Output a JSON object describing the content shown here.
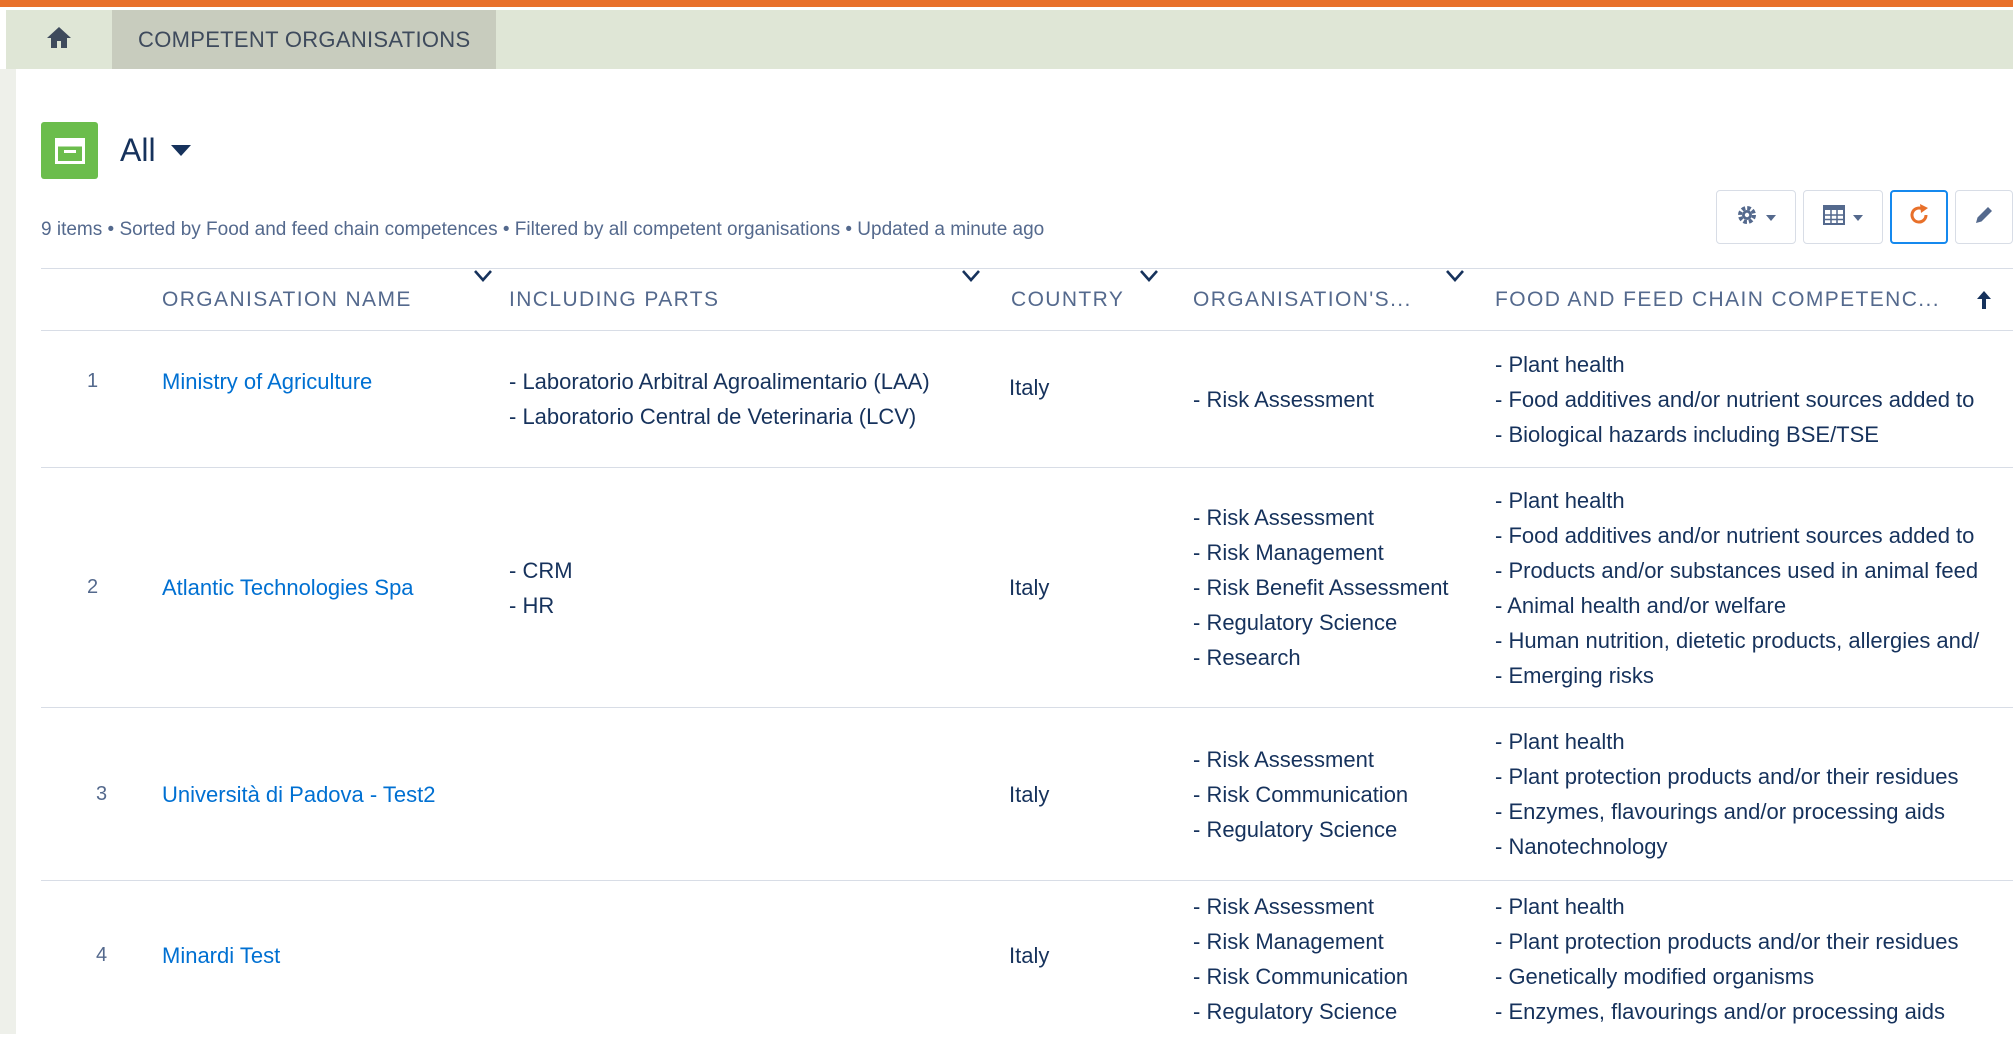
{
  "nav": {
    "tab_label": "COMPETENT ORGANISATIONS"
  },
  "list_view": {
    "title": "All",
    "summary": "9 items • Sorted by Food and feed chain competences • Filtered by all competent organisations • Updated a minute ago"
  },
  "table": {
    "columns": [
      "ORGANISATION NAME",
      "INCLUDING PARTS",
      "COUNTRY",
      "ORGANISATION'S...",
      "FOOD AND FEED CHAIN COMPETENC..."
    ],
    "rows": [
      {
        "num": "1",
        "name": "Ministry of Agriculture",
        "parts": [
          "- Laboratorio Arbitral Agroalimentario (LAA)",
          "- Laboratorio Central de Veterinaria (LCV)"
        ],
        "country": "Italy",
        "roles": [
          "- Risk Assessment"
        ],
        "competences": [
          "- Plant health",
          "- Food additives and/or nutrient sources added to",
          "- Biological hazards including BSE/TSE"
        ]
      },
      {
        "num": "2",
        "name": "Atlantic Technologies Spa",
        "parts": [
          "- CRM",
          "- HR"
        ],
        "country": "Italy",
        "roles": [
          "- Risk Assessment",
          "- Risk Management",
          "- Risk Benefit Assessment",
          "- Regulatory Science",
          "- Research"
        ],
        "competences": [
          "- Plant health",
          "- Food additives and/or nutrient sources added to",
          "- Products and/or substances used in animal feed",
          "- Animal health and/or welfare",
          "- Human nutrition, dietetic products, allergies and/",
          "- Emerging risks"
        ]
      },
      {
        "num": "3",
        "name": "Università di Padova - Test2",
        "parts": [],
        "country": "Italy",
        "roles": [
          "- Risk Assessment",
          "- Risk Communication",
          "- Regulatory Science"
        ],
        "competences": [
          "- Plant health",
          "- Plant protection products and/or their residues",
          "- Enzymes, flavourings and/or processing aids",
          "- Nanotechnology"
        ]
      },
      {
        "num": "4",
        "name": "Minardi Test",
        "parts": [],
        "country": "Italy",
        "roles": [
          "- Risk Assessment",
          "- Risk Management",
          "- Risk Communication",
          "- Regulatory Science"
        ],
        "competences": [
          "- Plant health",
          "- Plant protection products and/or their residues",
          "- Genetically modified organisms",
          "- Enzymes, flavourings and/or processing aids"
        ]
      }
    ]
  },
  "icons": {
    "home": "home-icon",
    "list": "list-view-icon",
    "settings": "gear-icon",
    "table_view": "table-view-icon",
    "refresh": "refresh-icon",
    "edit": "pencil-icon",
    "sort": "sort-ascending-icon"
  },
  "colors": {
    "accent_orange": "#e8702a",
    "tab_bg": "#dfe6d6",
    "link": "#0070d2",
    "list_icon_bg": "#6bbd4c",
    "refresh": "#e8702a"
  }
}
